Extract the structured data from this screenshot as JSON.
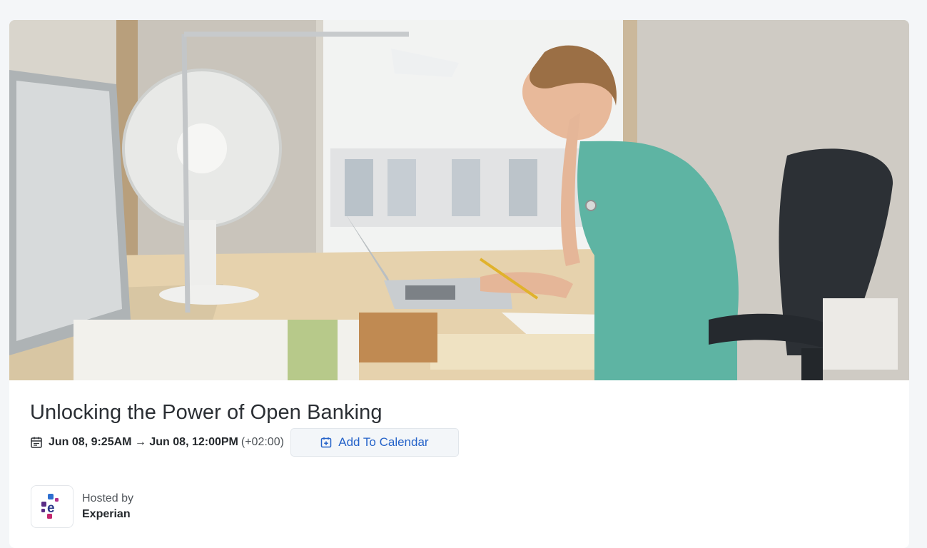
{
  "event": {
    "title": "Unlocking the Power of Open Banking",
    "date_range": "Jun 08, 9:25AM → Jun 08, 12:00PM",
    "timezone": "(+02:00)",
    "add_to_calendar_label": "Add To Calendar"
  },
  "host": {
    "hosted_by_label": "Hosted by",
    "name": "Experian"
  },
  "icons": {
    "date": "calendar-icon",
    "add_calendar": "calendar-plus-icon",
    "host_logo": "experian-logo"
  },
  "colors": {
    "accent": "#2563c9",
    "page_bg": "#f4f6f8",
    "card_bg": "#ffffff",
    "button_bg": "#f3f6f9"
  }
}
